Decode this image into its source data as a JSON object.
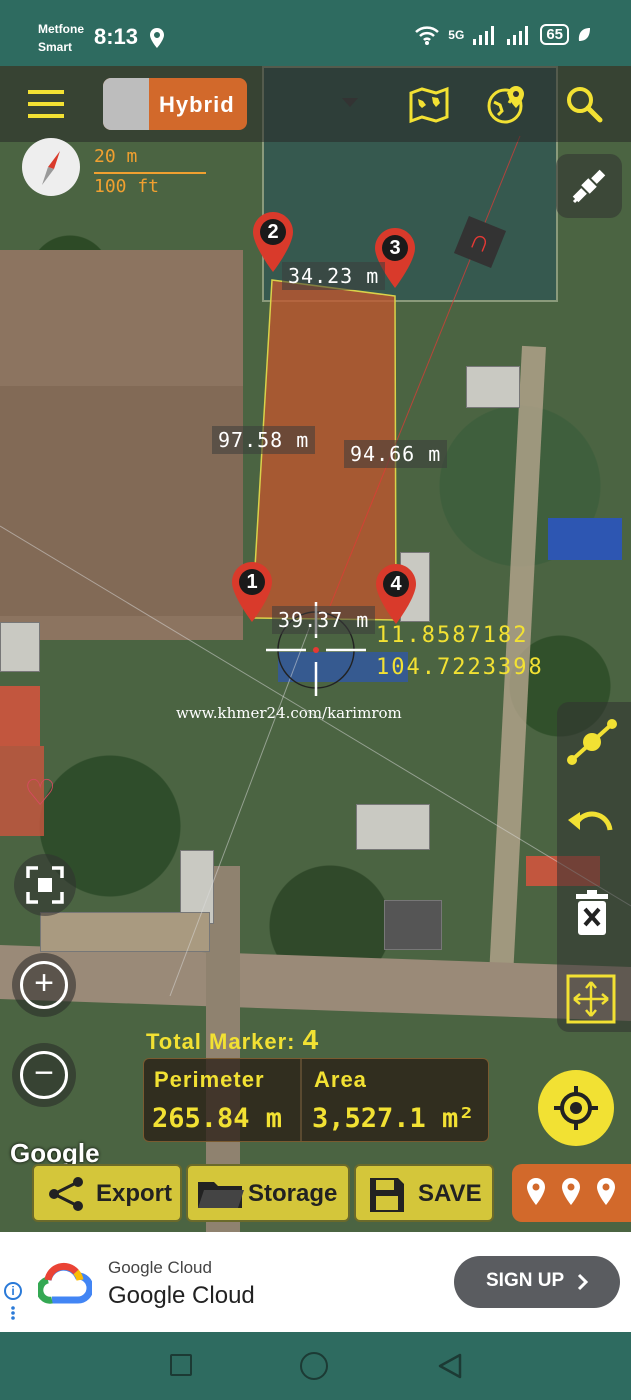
{
  "status_bar": {
    "carrier": "Metfone\nSmart",
    "time": "8:13",
    "network": "5G",
    "battery": "65"
  },
  "toolbar": {
    "map_type_label": "Hybrid",
    "menu_icon": "hamburger-menu-icon",
    "icons": [
      "world-map-icon",
      "globe-location-icon",
      "search-icon"
    ]
  },
  "scale": {
    "meters": "20 m",
    "feet": "100 ft"
  },
  "measurements": {
    "side_2_3": "34.23 m",
    "side_1_2": "97.58 m",
    "side_3_4": "94.66 m",
    "side_1_4": "39.37 m"
  },
  "markers": [
    "1",
    "2",
    "3",
    "4"
  ],
  "coordinates": {
    "lat": "11.8587182",
    "lng": "104.7223398"
  },
  "watermark": "www.khmer24.com/karimrom",
  "summary": {
    "total_marker_label": "Total Marker:",
    "total_marker_value": "4",
    "perimeter_label": "Perimeter",
    "perimeter_value": "265.84 m",
    "area_label": "Area",
    "area_value": "3,527.1 m²"
  },
  "google_label": "Google",
  "actions": {
    "export": "Export",
    "storage": "Storage",
    "save": "SAVE"
  },
  "ad": {
    "brand_small": "Google Cloud",
    "brand_big": "Google Cloud",
    "cta": "SIGN UP"
  },
  "colors": {
    "accent_yellow": "#f2e133",
    "accent_orange": "#d2692b",
    "status_bar": "#2e6b60",
    "polygon_fill": "#c0562e"
  }
}
